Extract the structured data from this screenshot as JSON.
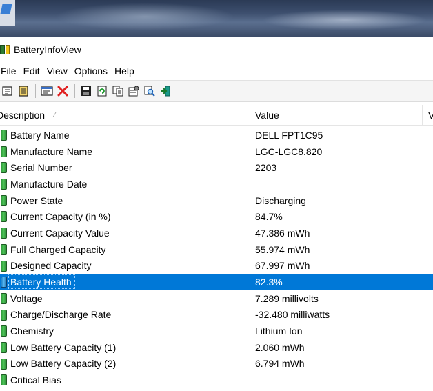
{
  "window": {
    "title": "BatteryInfoView"
  },
  "menu": [
    "File",
    "Edit",
    "View",
    "Options",
    "Help"
  ],
  "toolbar_icons": [
    "html-report-icon",
    "text-report-icon",
    "properties-icon",
    "delete-icon",
    "save-icon",
    "refresh-icon",
    "copy-icon",
    "options-icon",
    "find-icon",
    "exit-icon"
  ],
  "columns": {
    "description": "Description",
    "value": "Value",
    "more": "V"
  },
  "rows": [
    {
      "desc": "Battery Name",
      "value": "DELL FPT1C95"
    },
    {
      "desc": "Manufacture Name",
      "value": "LGC-LGC8.820"
    },
    {
      "desc": "Serial Number",
      "value": "2203"
    },
    {
      "desc": "Manufacture Date",
      "value": ""
    },
    {
      "desc": "Power State",
      "value": "Discharging"
    },
    {
      "desc": "Current Capacity (in %)",
      "value": "84.7%"
    },
    {
      "desc": "Current Capacity Value",
      "value": "47.386 mWh"
    },
    {
      "desc": "Full Charged Capacity",
      "value": "55.974 mWh"
    },
    {
      "desc": "Designed Capacity",
      "value": "67.997 mWh"
    },
    {
      "desc": "Battery Health",
      "value": "82.3%"
    },
    {
      "desc": "Voltage",
      "value": "7.289 millivolts"
    },
    {
      "desc": "Charge/Discharge Rate",
      "value": "-32.480 milliwatts"
    },
    {
      "desc": "Chemistry",
      "value": "Lithium Ion"
    },
    {
      "desc": "Low Battery Capacity (1)",
      "value": "2.060 mWh"
    },
    {
      "desc": "Low Battery Capacity (2)",
      "value": "6.794 mWh"
    },
    {
      "desc": "Critical Bias",
      "value": ""
    }
  ],
  "selected_row": "Battery Health",
  "colors": {
    "selection": "#0078d7"
  }
}
